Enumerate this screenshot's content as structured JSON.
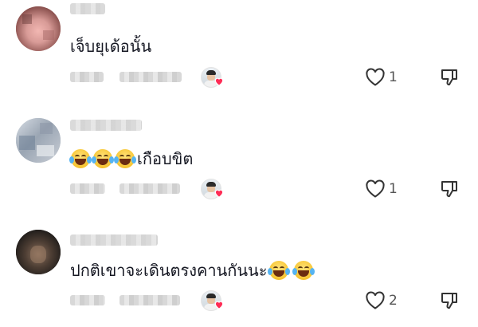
{
  "comments": [
    {
      "text": "เจ็บยุเด้อนั้น",
      "emojis_before": 0,
      "emojis_after": 0,
      "like_count": "1",
      "creator_liked": true
    },
    {
      "text": "เกือบขิต",
      "emojis_before": 3,
      "emojis_after": 0,
      "like_count": "1",
      "creator_liked": true
    },
    {
      "text": "ปกติเขาจะเดินตรงคานกันนะ",
      "emojis_before": 0,
      "emojis_after": 2,
      "like_count": "2",
      "creator_liked": true
    }
  ],
  "icons": {
    "like": "heart-outline-icon",
    "dislike": "thumbs-down-icon",
    "creator_heart": "red-heart-icon",
    "emoji": "face-with-tears-of-joy-emoji"
  },
  "colors": {
    "heart_red": "#fe2c55",
    "text": "#161823",
    "count": "#555555"
  }
}
